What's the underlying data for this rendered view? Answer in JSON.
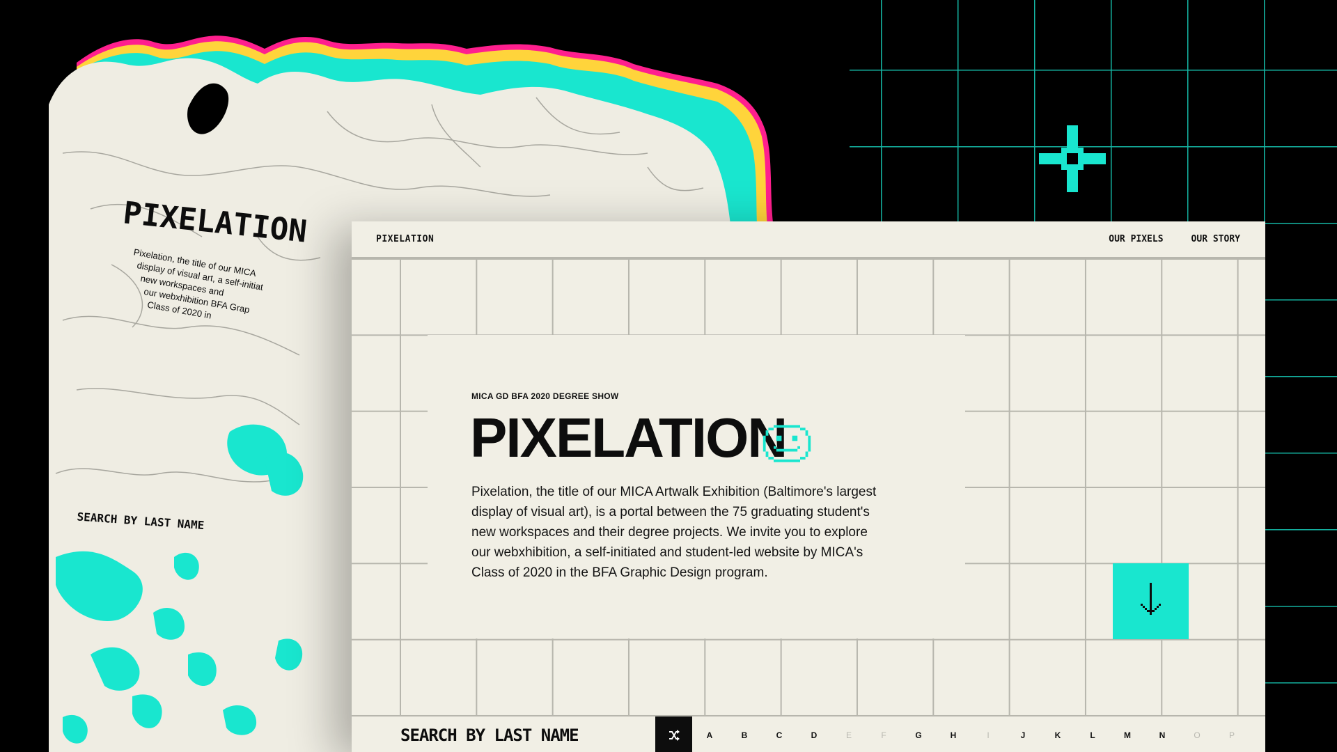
{
  "colors": {
    "accent": "#19e6cf",
    "paper": "#f1efe5",
    "grid_line": "#b7b6ad",
    "magenta": "#ff1f8e",
    "black": "#000000"
  },
  "back_mock": {
    "warped_title": "PIXELATION",
    "warped_search": "SEARCH BY LAST NAME"
  },
  "header": {
    "brand": "PIXELATION",
    "nav": [
      "OUR PIXELS",
      "OUR STORY"
    ]
  },
  "hero": {
    "eyebrow": "MICA GD BFA 2020 DEGREE SHOW",
    "title": "PIXELATION",
    "body": "Pixelation, the title of our MICA Artwalk Exhibition (Baltimore's largest display of visual art), is a portal between the 75 graduating student's new workspaces and their degree projects. We invite you to explore our webxhibition, a self-initiated and student-led website by MICA's Class of 2020 in the BFA Graphic Design program."
  },
  "icons": {
    "plus": "pixel-plus-icon",
    "smiley": "pixel-smiley-icon",
    "down": "down-arrow-icon",
    "shuffle": "shuffle-icon"
  },
  "search": {
    "label": "SEARCH BY LAST NAME",
    "letters": [
      {
        "char": "A",
        "active": true
      },
      {
        "char": "B",
        "active": true
      },
      {
        "char": "C",
        "active": true
      },
      {
        "char": "D",
        "active": true
      },
      {
        "char": "E",
        "active": false
      },
      {
        "char": "F",
        "active": false
      },
      {
        "char": "G",
        "active": true
      },
      {
        "char": "H",
        "active": true
      },
      {
        "char": "I",
        "active": false
      },
      {
        "char": "J",
        "active": true
      },
      {
        "char": "K",
        "active": true
      },
      {
        "char": "L",
        "active": true
      },
      {
        "char": "M",
        "active": true
      },
      {
        "char": "N",
        "active": true
      },
      {
        "char": "O",
        "active": false
      },
      {
        "char": "P",
        "active": false
      }
    ]
  }
}
